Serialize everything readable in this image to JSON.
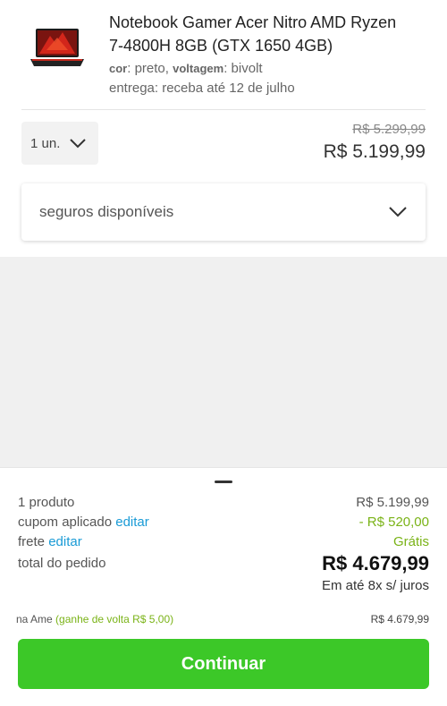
{
  "product": {
    "title": "Notebook Gamer Acer Nitro AMD Ryzen 7-4800H 8GB (GTX 1650 4GB)",
    "attr_color_label": "cor",
    "attr_color_value": "preto",
    "attr_voltage_label": "voltagem",
    "attr_voltage_value": "bivolt",
    "delivery": "entrega: receba até 12 de julho",
    "image_icon": "laptop-icon"
  },
  "quantity": {
    "value": "1 un.",
    "icon": "chevron-down-icon"
  },
  "pricing": {
    "old": "R$ 5.299,99",
    "current": "R$ 5.199,99"
  },
  "insurance": {
    "label": "seguros disponíveis",
    "icon": "chevron-down-icon"
  },
  "summary": {
    "products_label": "1 produto",
    "products_value": "R$ 5.199,99",
    "coupon_label": "cupom aplicado",
    "coupon_edit": "editar",
    "coupon_value": "- R$ 520,00",
    "shipping_label": "frete",
    "shipping_edit": "editar",
    "shipping_value": "Grátis",
    "total_label": "total do pedido",
    "total_value": "R$ 4.679,99",
    "installments": "Em até 8x s/ juros",
    "ame_label": "na Ame",
    "ame_cashback": "(ganhe de volta R$ 5,00)",
    "ame_value": "R$ 4.679,99"
  },
  "cta": {
    "label": "Continuar"
  },
  "colors": {
    "accent_green": "#3cc828",
    "link_blue": "#1a9bd6",
    "discount_green": "#7ab317"
  }
}
